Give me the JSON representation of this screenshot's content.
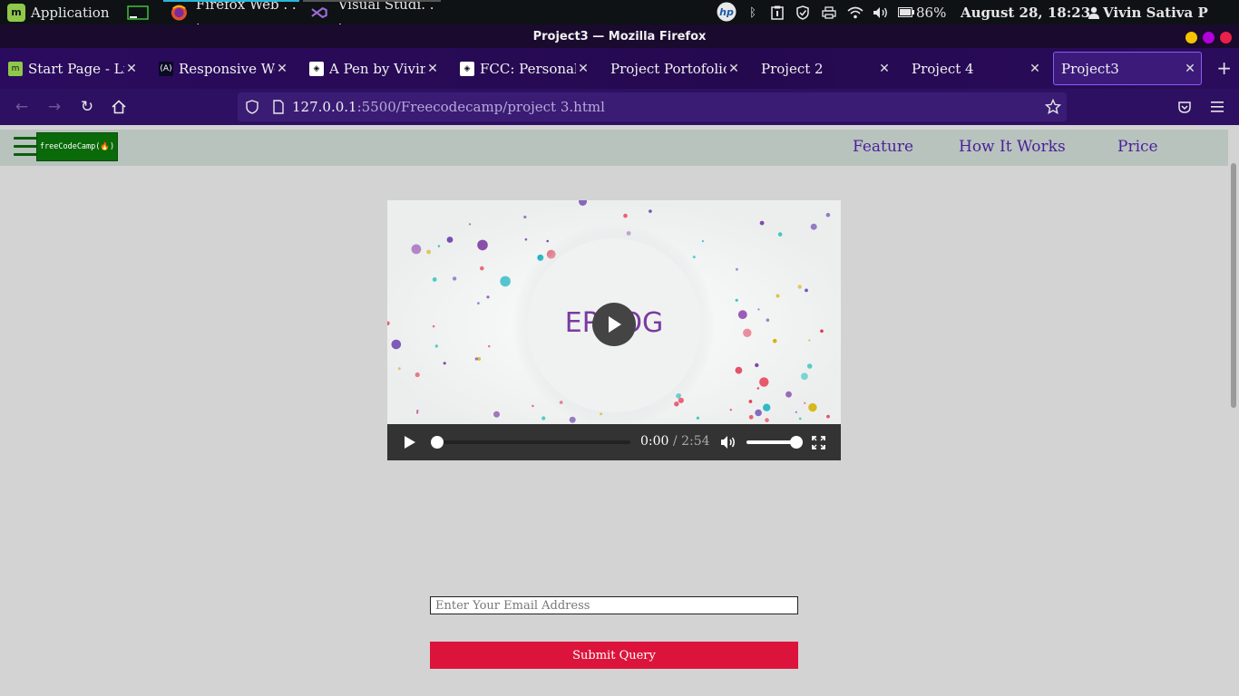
{
  "panel": {
    "app_menu_label": "Application",
    "tasks": [
      {
        "label": "Firefox Web . . .",
        "accent": "#29b6d6"
      },
      {
        "label": "Visual Studi. . .",
        "accent": "#555555"
      }
    ],
    "battery": "86%",
    "datetime": "August 28, 18:23",
    "user": "Vivin Sativa P"
  },
  "window": {
    "title": "Project3 — Mozilla Firefox"
  },
  "tabs": [
    {
      "label": "Start Page - Linux Mint",
      "icon": "mint-icon"
    },
    {
      "label": "Responsive Web Design",
      "icon": "freecodecamp-icon"
    },
    {
      "label": "A Pen by Vivin Sativa",
      "icon": "codepen-icon"
    },
    {
      "label": "FCC: Personal Portfolio",
      "icon": "codepen-icon"
    },
    {
      "label": "Project Portofolio",
      "icon": ""
    },
    {
      "label": "Project 2",
      "icon": ""
    },
    {
      "label": "Project 4",
      "icon": ""
    },
    {
      "label": "Project3",
      "icon": "",
      "active": true
    }
  ],
  "urlbar": {
    "host": "127.0.0.1",
    "path": ":5500/Freecodecamp/project 3.html"
  },
  "site": {
    "logo_text": "freeCodeCamp(🔥)",
    "nav": [
      "Feature",
      "How It Works",
      "Price"
    ]
  },
  "video": {
    "title_text": "EPILOG",
    "current_time": "0:00",
    "duration": "/ 2:54",
    "progress": 0,
    "volume": 1.0
  },
  "form": {
    "email_placeholder": "Enter Your Email Address",
    "submit_label": "Submit Query"
  },
  "colors": {
    "accent_submit": "#dc143c",
    "nav_link": "#4a1f9a",
    "logo_bg": "#0a6a0a"
  }
}
